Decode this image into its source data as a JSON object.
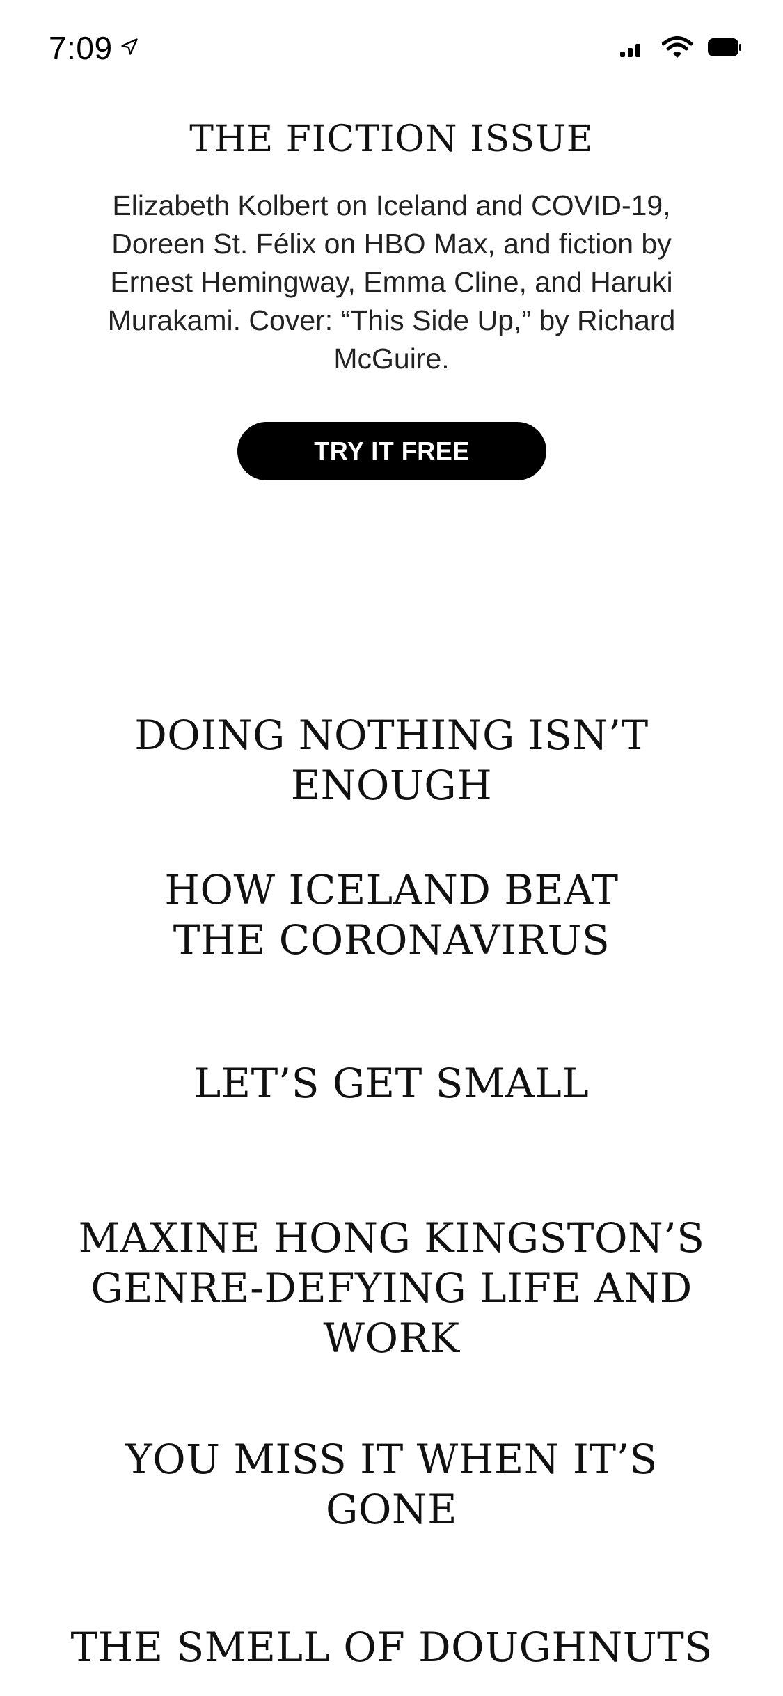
{
  "status_bar": {
    "time": "7:09",
    "icons": [
      "location-arrow-icon",
      "cellular-signal-icon",
      "wifi-icon",
      "battery-icon"
    ]
  },
  "issue": {
    "title": "THE FICTION ISSUE",
    "description": "Elizabeth Kolbert on Iceland and COVID-19, Doreen St. Félix on HBO Max, and fiction by Ernest Hemingway, Emma Cline, and Haruki Murakami. Cover: “This Side Up,” by Richard McGuire.",
    "cta_label": "TRY IT FREE"
  },
  "articles": [
    {
      "title": "DOING NOTHING ISN’T ENOUGH"
    },
    {
      "title": "HOW ICELAND BEAT THE CORONAVIRUS"
    },
    {
      "title": "LET’S GET SMALL"
    },
    {
      "title": "MAXINE HONG KINGSTON’S GENRE-DEFYING LIFE AND WORK"
    },
    {
      "title": "YOU MISS IT WHEN IT’S GONE"
    },
    {
      "title": "THE SMELL OF DOUGHNUTS"
    }
  ],
  "colors": {
    "background": "#ffffff",
    "text": "#111111",
    "button_bg": "#000000",
    "button_text": "#ffffff"
  }
}
